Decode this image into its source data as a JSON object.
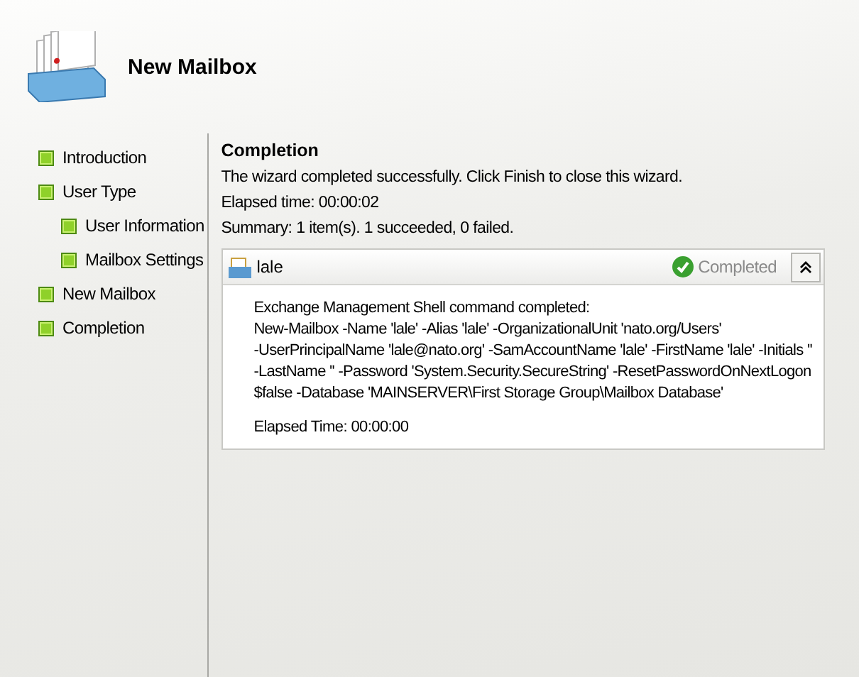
{
  "header": {
    "title": "New Mailbox"
  },
  "steps": [
    {
      "label": "Introduction"
    },
    {
      "label": "User Type",
      "children": [
        {
          "label": "User Information"
        },
        {
          "label": "Mailbox Settings"
        }
      ]
    },
    {
      "label": "New Mailbox"
    },
    {
      "label": "Completion"
    }
  ],
  "content": {
    "heading": "Completion",
    "lines": [
      "The wizard completed successfully. Click Finish to close this wizard.",
      "Elapsed time: 00:00:02",
      "Summary: 1 item(s). 1 succeeded, 0 failed."
    ],
    "result": {
      "name": "lale",
      "status": "Completed",
      "expanded": true,
      "output": [
        "Exchange Management Shell command completed:",
        "New-Mailbox -Name 'lale' -Alias 'lale' -OrganizationalUnit 'nato.org/Users'",
        "-UserPrincipalName 'lale@nato.org' -SamAccountName 'lale' -FirstName 'lale' -Initials ''",
        "-LastName '' -Password 'System.Security.SecureString' -ResetPasswordOnNextLogon",
        "$false -Database 'MAINSERVER\\First Storage Group\\Mailbox Database'"
      ],
      "elapsed": "Elapsed Time: 00:00:00"
    }
  }
}
